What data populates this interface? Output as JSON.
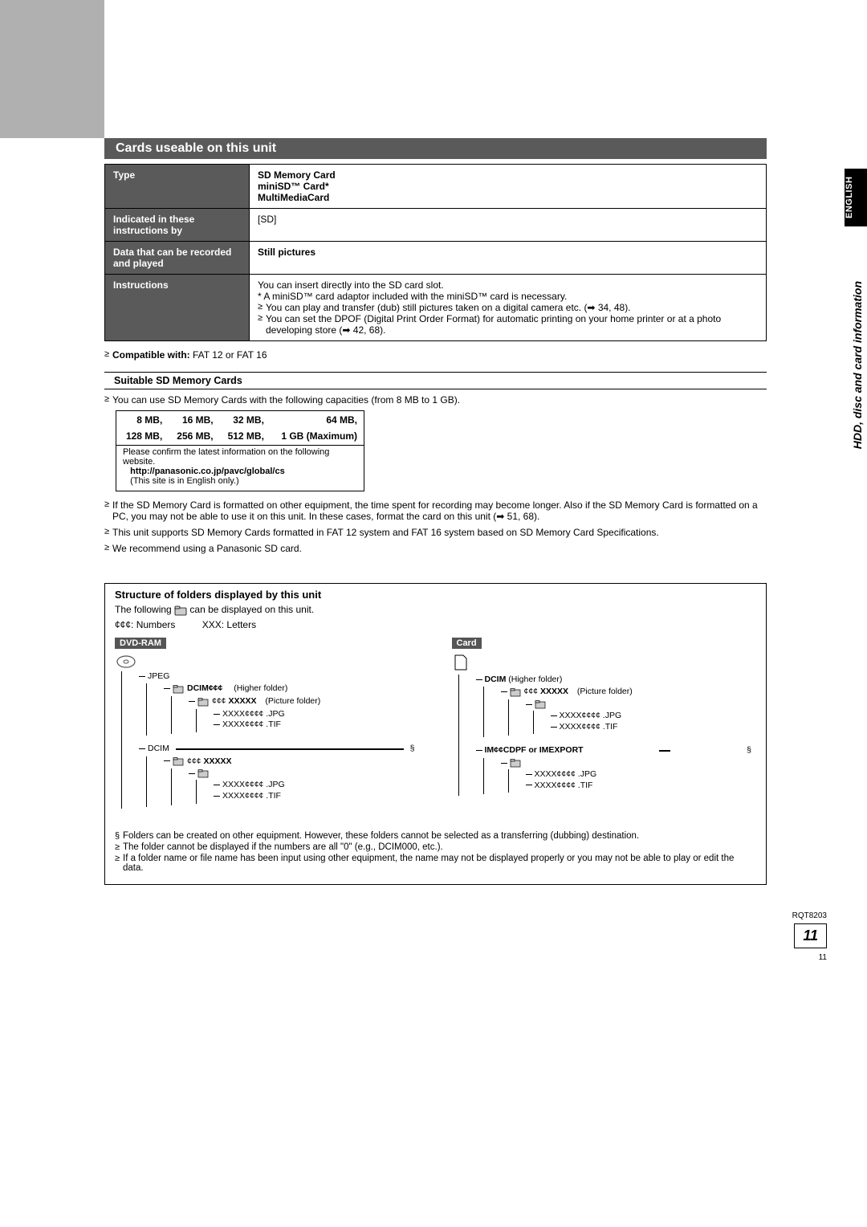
{
  "sideTab": "ENGLISH",
  "sideSection": "HDD, disc and card information",
  "header": "Cards useable on this unit",
  "specRows": {
    "r1h": "Type",
    "r1v": "SD Memory Card\nminiSD™ Card*\nMultiMediaCard",
    "r2h": "Indicated in these instructions by",
    "r2v": "[SD]",
    "r3h": "Data that can be recorded and played",
    "r3v": "Still pictures",
    "r4h": "Instructions",
    "r4v0": "You can insert directly into the SD card slot.",
    "r4v1": "* A miniSD™ card adaptor included with the miniSD™ card is necessary.",
    "r4b1": "You can play and transfer (dub) still pictures taken on a digital camera etc. (➡ 34, 48).",
    "r4b2": "You can set the DPOF (Digital Print Order Format) for automatic printing on your home printer or at a photo developing store (➡ 42, 68)."
  },
  "compatLabel": "Compatible with:",
  "compatVal": " FAT 12 or FAT 16",
  "subHeader": "Suitable SD Memory Cards",
  "capIntro": "You can use SD Memory Cards with the following capacities (from 8 MB to 1 GB).",
  "capacities": {
    "row1": [
      "8 MB,",
      "16 MB,",
      "32 MB,",
      "64 MB,"
    ],
    "row2": [
      "128 MB,",
      "256 MB,",
      "512 MB,",
      "1 GB (Maximum)"
    ]
  },
  "capNote1": "Please confirm the latest information on the following website.",
  "capUrl": "http://panasonic.co.jp/pavc/global/cs",
  "capNote2": "(This site is in English only.)",
  "notes": [
    "If the SD Memory Card is formatted on other equipment, the time spent for recording may become longer. Also if the SD Memory Card is formatted on a PC, you may not be able to use it on this unit. In these cases, format the card on this unit (➡ 51, 68).",
    "This unit supports SD Memory Cards formatted in FAT 12 system and FAT 16 system based on SD Memory Card Specifications.",
    "We recommend using a Panasonic SD card."
  ],
  "structure": {
    "title": "Structure of folders displayed by this unit",
    "intro1a": "The following ",
    "intro1b": " can be displayed on this unit.",
    "legend": "¢¢¢: Numbers          XXX: Letters",
    "left": {
      "label": "DVD-RAM",
      "jpeg": "JPEG",
      "dcimH": "DCIM¢¢¢",
      "higher": "(Higher folder)",
      "pic": "¢¢¢ XXXXX",
      "picL": "(Picture folder)",
      "f1": "XXXX¢¢¢¢    .JPG",
      "f2": "XXXX¢¢¢¢    .TIF",
      "dcim": "DCIM",
      "sub": "¢¢¢ XXXXX",
      "mark": "§"
    },
    "right": {
      "label": "Card",
      "dcimH": "DCIM",
      "higher": "(Higher folder)",
      "pic": "¢¢¢ XXXXX",
      "picL": "(Picture folder)",
      "f1": "XXXX¢¢¢¢    .JPG",
      "f2": "XXXX¢¢¢¢    .TIF",
      "imp": "IM¢¢CDPF or IMEXPORT",
      "mark": "§"
    },
    "foot": [
      "Folders can be created on other equipment. However, these folders cannot be selected as a transferring (dubbing) destination.",
      "The folder cannot be displayed if the numbers are all \"0\" (e.g., DCIM000, etc.).",
      "If a folder name or file name has been input using other equipment, the name may not be displayed properly or you may not be able to play or edit the data."
    ]
  },
  "footer": {
    "code": "RQT8203",
    "page": "11",
    "small": "11"
  }
}
